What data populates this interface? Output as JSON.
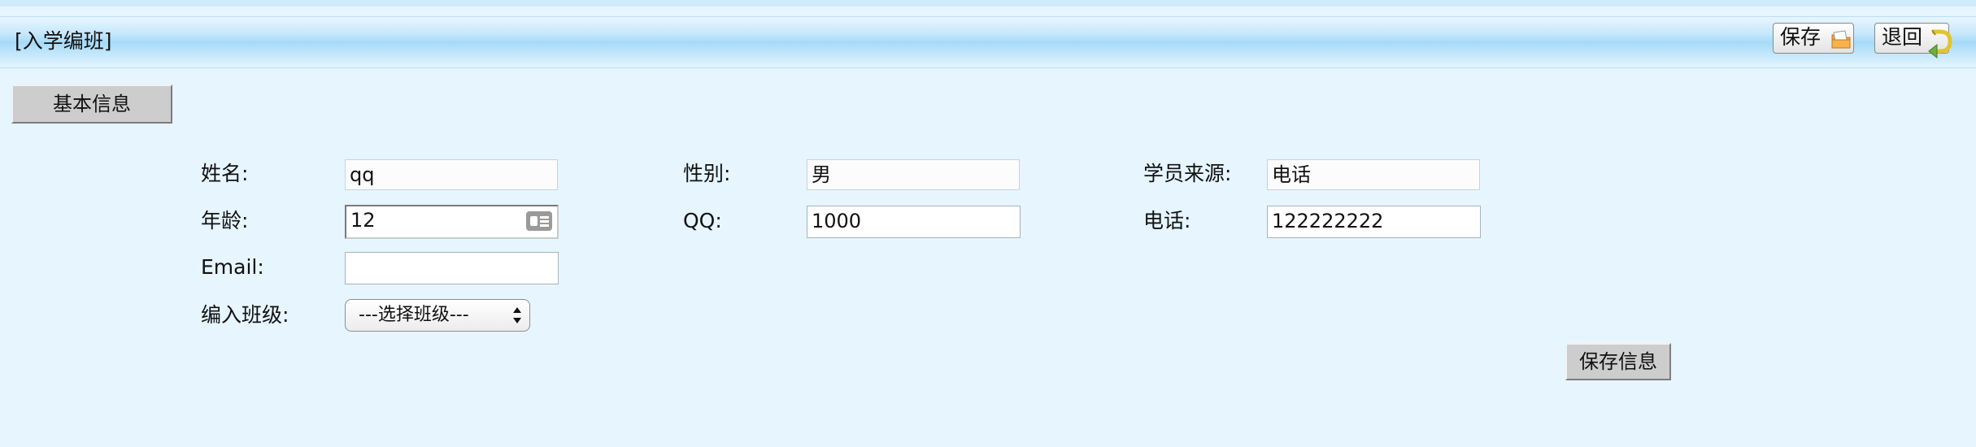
{
  "header": {
    "title": "[入学编班]",
    "save_label": "保存",
    "back_label": "退回"
  },
  "tabs": {
    "basic_info": "基本信息"
  },
  "form": {
    "name": {
      "label": "姓名:",
      "value": "qq"
    },
    "gender": {
      "label": "性别:",
      "value": "男"
    },
    "source": {
      "label": "学员来源:",
      "value": "电话"
    },
    "age": {
      "label": "年龄:",
      "value": "12"
    },
    "qq": {
      "label": "QQ:",
      "value": "1000"
    },
    "phone": {
      "label": "电话:",
      "value": "122222222"
    },
    "email": {
      "label": "Email:",
      "value": ""
    },
    "class": {
      "label": "编入班级:",
      "selected": "---选择班级---"
    }
  },
  "actions": {
    "save_info": "保存信息"
  },
  "colors": {
    "page_bg": "#e6f5fe",
    "header_gradient_mid": "#a6daf7",
    "button_gray": "#cdcdcd"
  },
  "icons": {
    "save": "folder-save-icon",
    "back": "return-arrow-icon",
    "contact": "contact-card-icon",
    "select": "select-arrows-icon"
  }
}
